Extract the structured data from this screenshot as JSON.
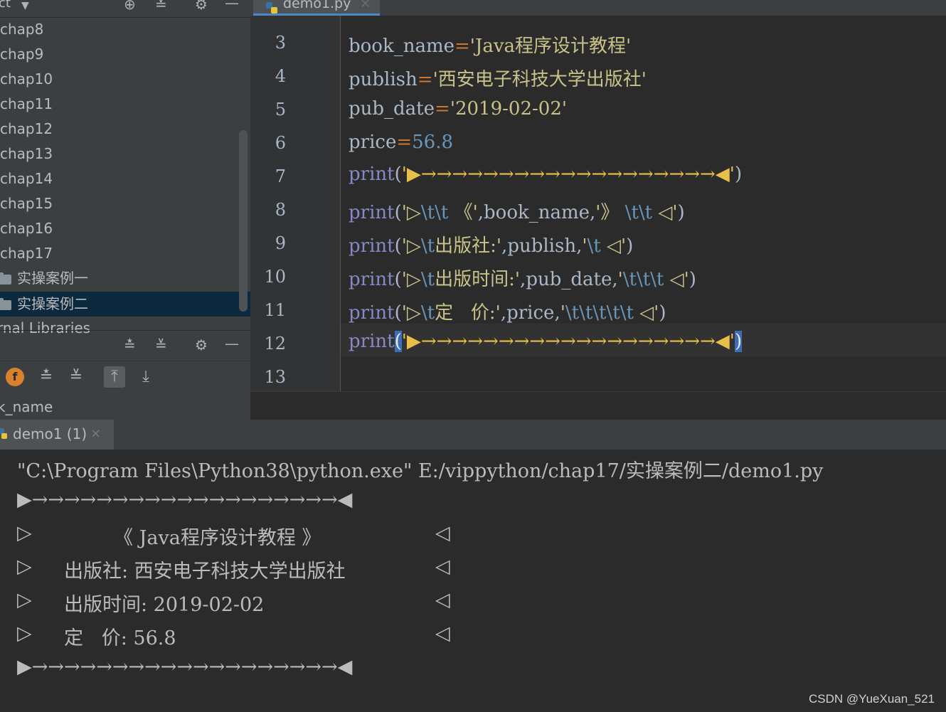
{
  "project_panel": {
    "title": "ct",
    "tree_items": [
      "chap8",
      "chap9",
      "chap10",
      "chap11",
      "chap12",
      "chap13",
      "chap14",
      "chap15",
      "chap16",
      "chap17"
    ],
    "folders": [
      "实操案例一",
      "实操案例二"
    ],
    "partial_item": "rnal Libraries"
  },
  "structure_panel": {
    "item": "k_name"
  },
  "editor": {
    "tab_label": "demo1.py",
    "line_numbers": [
      "3",
      "4",
      "5",
      "6",
      "7",
      "8",
      "9",
      "10",
      "11",
      "12",
      "13"
    ],
    "code": {
      "l3_var": "book_name",
      "l3_val": "'Java程序设计教程'",
      "l4_var": "publish",
      "l4_val": "'西安电子科技大学出版社'",
      "l5_var": "pub_date",
      "l5_val": "'2019-02-02'",
      "l6_var": "price",
      "l6_val": "56.8",
      "print_kw": "print",
      "l7_str": "'▶→→→→→→→→→→→→→→→→→→→◀'",
      "l8_a": "'▷",
      "l8_esc1": "\\t\\t",
      "l8_b": " 《'",
      "l8_var": "book_name",
      "l8_c": "'》",
      "l8_esc2": " \\t\\t",
      "l8_d": " ◁'",
      "l9_a": "'▷",
      "l9_esc1": "\\t",
      "l9_b": "出版社:'",
      "l9_var": "publish",
      "l9_c": "'",
      "l9_esc2": "\\t",
      "l9_d": " ◁'",
      "l10_a": "'▷",
      "l10_esc1": "\\t",
      "l10_b": "出版时间:'",
      "l10_var": "pub_date",
      "l10_c": "'",
      "l10_esc2": "\\t\\t\\t",
      "l10_d": " ◁'",
      "l11_a": "'▷",
      "l11_esc1": "\\t",
      "l11_b": "定   价:'",
      "l11_var": "price",
      "l11_c": "'",
      "l11_esc2": "\\t\\t\\t\\t\\t",
      "l11_d": " ◁'",
      "l12_str": "'▶→→→→→→→→→→→→→→→→→→→◀'"
    }
  },
  "run_panel": {
    "tab_label": "demo1 (1)",
    "command": "\"C:\\Program Files\\Python38\\python.exe\" E:/vippython/chap17/实操案例二/demo1.py",
    "border_line": "▶→→→→→→→→→→→→→→→→→→→◀",
    "row_title": "《 Java程序设计教程 》",
    "row_publish": "出版社: 西安电子科技大学出版社",
    "row_date": "出版时间: 2019-02-02",
    "row_price": "定   价: 56.8",
    "left_mark": "▷",
    "right_mark": "◁"
  },
  "watermark": "CSDN @YueXuan_521"
}
